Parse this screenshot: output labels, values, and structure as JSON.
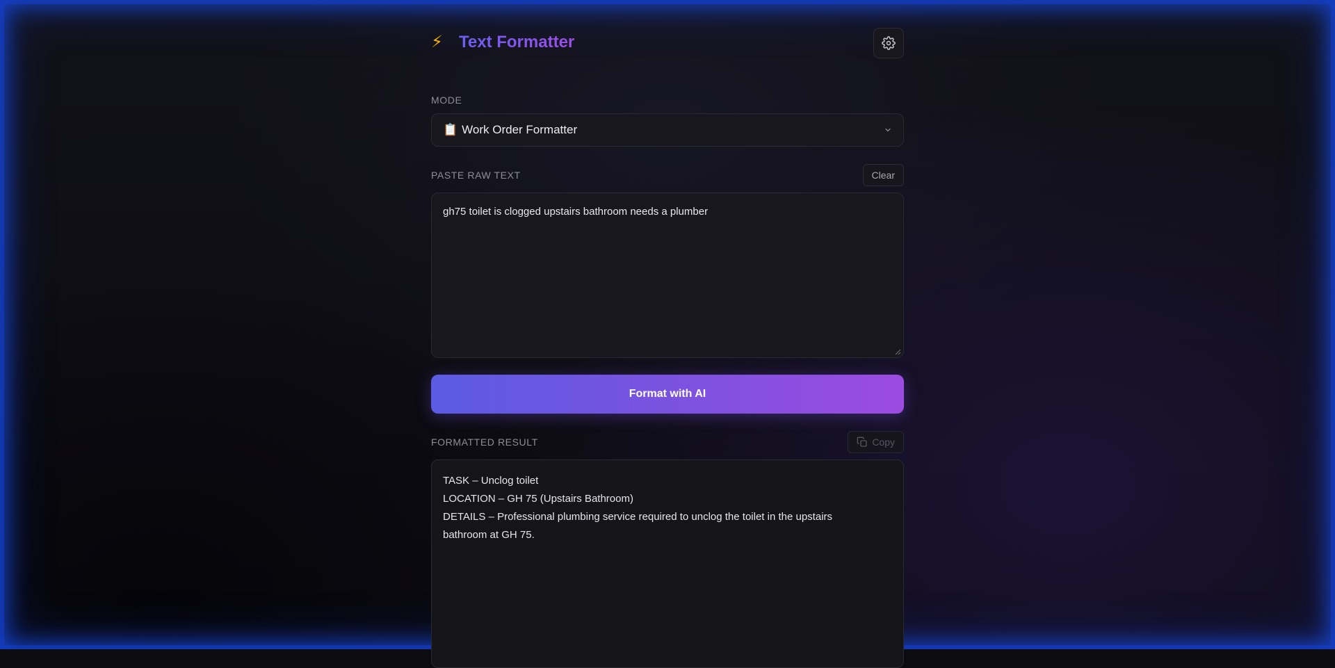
{
  "app": {
    "title": "Text Formatter",
    "title_icon": "⚡",
    "settings_icon": "gear-icon"
  },
  "mode": {
    "label": "MODE",
    "selected_icon": "📋",
    "selected": "Work Order Formatter"
  },
  "input": {
    "label": "PASTE RAW TEXT",
    "clear_label": "Clear",
    "value": "gh75 toilet is clogged upstairs bathroom needs a plumber"
  },
  "format_button": {
    "label": "Format with AI"
  },
  "result": {
    "label": "FORMATTED RESULT",
    "copy_label": "Copy",
    "lines": [
      "TASK – Unclog toilet",
      "LOCATION – GH 75 (Upstairs Bathroom)",
      "DETAILS – Professional plumbing service required to unclog the toilet in the upstairs",
      "bathroom at GH 75."
    ]
  },
  "colors": {
    "accent_start": "#5b5be3",
    "accent_end": "#9d4be0",
    "frame_glow": "#1a4ee6"
  }
}
